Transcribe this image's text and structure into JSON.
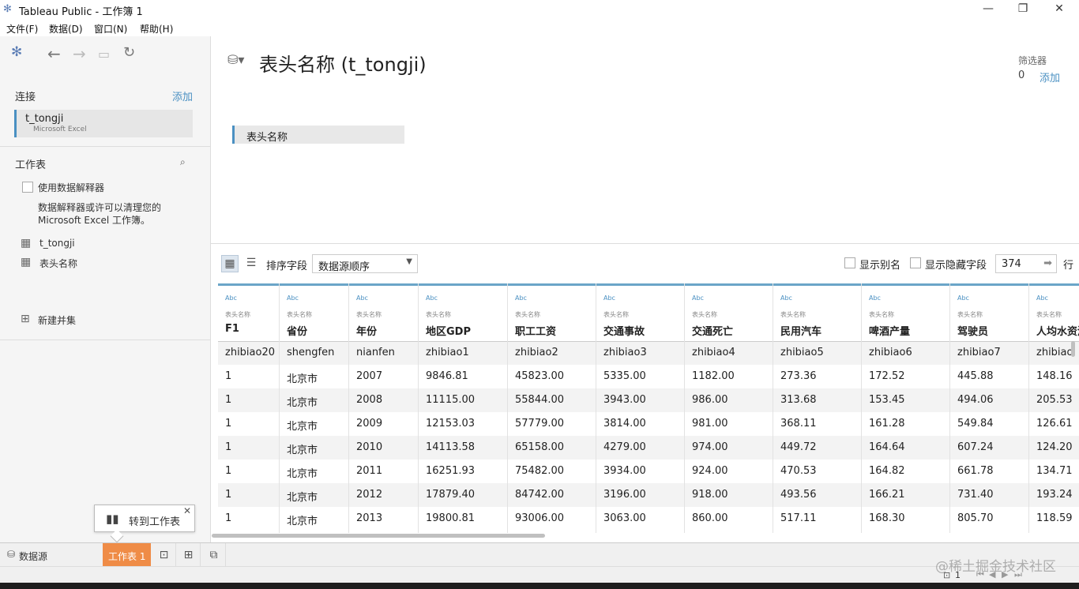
{
  "window": {
    "title": "Tableau Public - 工作簿 1",
    "minimize": "—",
    "maximize": "❐",
    "close": "✕"
  },
  "menu": [
    "文件(F)",
    "数据(D)",
    "窗口(N)",
    "帮助(H)"
  ],
  "left_panel": {
    "connections_label": "连接",
    "add_label": "添加",
    "connection": {
      "name": "t_tongji",
      "type": "Microsoft Excel"
    },
    "sheets_label": "工作表",
    "interpreter_label": "使用数据解释器",
    "interpreter_desc_1": "数据解释器或许可以清理您的",
    "interpreter_desc_2": "Microsoft Excel 工作簿。",
    "sheets": [
      "t_tongji",
      "表头名称"
    ],
    "new_union": "新建并集"
  },
  "main": {
    "title": "表头名称 (t_tongji)",
    "filter_label": "筛选器",
    "filter_count": "0",
    "filter_add": "添加",
    "canvas_table": "表头名称"
  },
  "grid_toolbar": {
    "sort_label": "排序字段",
    "sort_value": "数据源顺序",
    "show_alias": "显示别名",
    "show_hidden": "显示隐藏字段",
    "rows_value": "374",
    "rows_unit": "行"
  },
  "grid": {
    "columns": [
      {
        "type": "Abc",
        "source": "表头名称",
        "name": "F1"
      },
      {
        "type": "Abc",
        "source": "表头名称",
        "name": "省份"
      },
      {
        "type": "Abc",
        "source": "表头名称",
        "name": "年份"
      },
      {
        "type": "Abc",
        "source": "表头名称",
        "name": "地区GDP"
      },
      {
        "type": "Abc",
        "source": "表头名称",
        "name": "职工工资"
      },
      {
        "type": "Abc",
        "source": "表头名称",
        "name": "交通事故"
      },
      {
        "type": "Abc",
        "source": "表头名称",
        "name": "交通死亡"
      },
      {
        "type": "Abc",
        "source": "表头名称",
        "name": "民用汽车"
      },
      {
        "type": "Abc",
        "source": "表头名称",
        "name": "啤酒产量"
      },
      {
        "type": "Abc",
        "source": "表头名称",
        "name": "驾驶员"
      },
      {
        "type": "Abc",
        "source": "表头名称",
        "name": "人均水资源"
      }
    ],
    "rows": [
      [
        "zhibiao20",
        "shengfen",
        "nianfen",
        "zhibiao1",
        "zhibiao2",
        "zhibiao3",
        "zhibiao4",
        "zhibiao5",
        "zhibiao6",
        "zhibiao7",
        "zhibiao"
      ],
      [
        "1",
        "北京市",
        "2007",
        "9846.81",
        "45823.00",
        "5335.00",
        "1182.00",
        "273.36",
        "172.52",
        "445.88",
        "148.16"
      ],
      [
        "1",
        "北京市",
        "2008",
        "11115.00",
        "55844.00",
        "3943.00",
        "986.00",
        "313.68",
        "153.45",
        "494.06",
        "205.53"
      ],
      [
        "1",
        "北京市",
        "2009",
        "12153.03",
        "57779.00",
        "3814.00",
        "981.00",
        "368.11",
        "161.28",
        "549.84",
        "126.61"
      ],
      [
        "1",
        "北京市",
        "2010",
        "14113.58",
        "65158.00",
        "4279.00",
        "974.00",
        "449.72",
        "164.64",
        "607.24",
        "124.20"
      ],
      [
        "1",
        "北京市",
        "2011",
        "16251.93",
        "75482.00",
        "3934.00",
        "924.00",
        "470.53",
        "164.82",
        "661.78",
        "134.71"
      ],
      [
        "1",
        "北京市",
        "2012",
        "17879.40",
        "84742.00",
        "3196.00",
        "918.00",
        "493.56",
        "166.21",
        "731.40",
        "193.24"
      ],
      [
        "1",
        "北京市",
        "2013",
        "19800.81",
        "93006.00",
        "3063.00",
        "860.00",
        "517.11",
        "168.30",
        "805.70",
        "118.59"
      ]
    ]
  },
  "tooltip": {
    "label": "转到工作表",
    "close": "✕"
  },
  "tabs": {
    "datasource": "数据源",
    "sheet": "工作表 1"
  },
  "status": {
    "page": "1"
  },
  "watermark": "@稀土掘金技术社区",
  "colors": {
    "accent": "#4a90c2",
    "active_tab": "#ef8c47",
    "grid_header_border": "#6ba5c8"
  }
}
